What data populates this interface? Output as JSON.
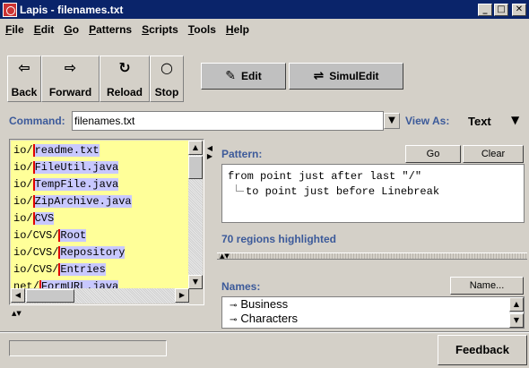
{
  "window": {
    "title": "Lapis - filenames.txt"
  },
  "menu": [
    {
      "first": "F",
      "rest": "ile"
    },
    {
      "first": "E",
      "rest": "dit"
    },
    {
      "first": "G",
      "rest": "o"
    },
    {
      "first": "P",
      "rest": "atterns"
    },
    {
      "first": "S",
      "rest": "cripts"
    },
    {
      "first": "T",
      "rest": "ools"
    },
    {
      "first": "H",
      "rest": "elp"
    }
  ],
  "toolbar": {
    "back": "Back",
    "forward": "Forward",
    "reload": "Reload",
    "stop": "Stop",
    "edit": "Edit",
    "simuledit": "SimulEdit"
  },
  "command": {
    "label": "Command:",
    "value": "filenames.txt",
    "viewas_label": "View As:",
    "viewas_value": "Text"
  },
  "files": [
    {
      "prefix": "io/",
      "hl": "readme.txt"
    },
    {
      "prefix": "io/",
      "hl": "FileUtil.java"
    },
    {
      "prefix": "io/",
      "hl": "TempFile.java"
    },
    {
      "prefix": "io/",
      "hl": "ZipArchive.java"
    },
    {
      "prefix": "io/",
      "hl": "CVS"
    },
    {
      "prefix": "io/CVS/",
      "hl": "Root"
    },
    {
      "prefix": "io/CVS/",
      "hl": "Repository"
    },
    {
      "prefix": "io/CVS/",
      "hl": "Entries"
    },
    {
      "prefix": "net/",
      "hl": "FormURL.java"
    }
  ],
  "pattern": {
    "label": "Pattern:",
    "go": "Go",
    "clear": "Clear",
    "line1": "from point just after last \"/\"",
    "line2": "to point just before Linebreak"
  },
  "regions_text": "70 regions highlighted",
  "names": {
    "label": "Names:",
    "button": "Name...",
    "items": [
      "Business",
      "Characters"
    ]
  },
  "feedback": "Feedback"
}
